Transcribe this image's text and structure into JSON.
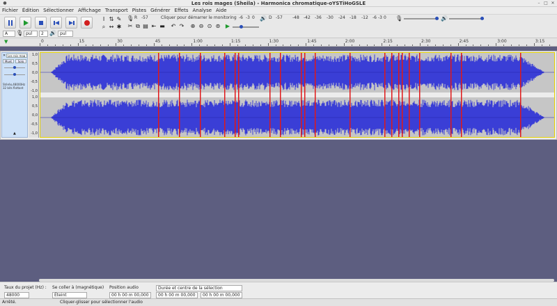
{
  "window": {
    "title": "Les rois mages (Sheila) - Harmonica chromatique-oYSTiHoGSLE",
    "menus": [
      "Fichier",
      "Édition",
      "Sélectionner",
      "Affichage",
      "Transport",
      "Pistes",
      "Générer",
      "Effets",
      "Analyse",
      "Aide"
    ]
  },
  "toolbar": {
    "record_meter_label": "R",
    "play_meter_label": "D",
    "record_meter_ticks": [
      "-57",
      "Cliquer pour démarrer le monitoring",
      "-6",
      "-3",
      "0"
    ],
    "play_meter_ticks": [
      "-57",
      "-48",
      "-42",
      "-36",
      "-30",
      "-24",
      "-18",
      "-12",
      "-6",
      "-3",
      "0"
    ],
    "host": "A",
    "record_device": "pul",
    "channels": "2",
    "playback_device": "pul"
  },
  "timeline": {
    "labels": [
      "0",
      "15",
      "30",
      "45",
      "1:00",
      "1:15",
      "1:30",
      "1:45",
      "2:00",
      "2:15",
      "2:30",
      "2:45",
      "3:00",
      "3:15"
    ]
  },
  "track": {
    "name": "Les rois mag",
    "mute": "Muet",
    "solo": "Solo",
    "info1": "Stéréo,48000Hz",
    "info2": "32 bits flottant",
    "ruler_top": [
      "1,0",
      "0,5",
      "0,0",
      "-0,5",
      "-1,0"
    ],
    "ruler_bottom": [
      "1,0",
      "0,5",
      "0,0",
      "-0,5",
      "-1,0"
    ]
  },
  "bottom": {
    "rate_label": "Taux du projet (Hz) :",
    "rate_value": "48000",
    "snap_label": "Se coller à (magnétique)",
    "snap_value": "Éteint",
    "pos_label": "Position audio",
    "pos_value": "00 h 00 m 00,000 s",
    "sel_mode": "Durée et centre de la sélection",
    "sel_start": "00 h 00 m 00,000 s",
    "sel_end": "00 h 00 m 00,000 s"
  },
  "status": {
    "state": "Arrêté.",
    "hint": "Cliquer-glisser pour sélectionner l'audio"
  },
  "colors": {
    "waveform": "#3a3ed6",
    "waveform_bg": "#c6c6c6",
    "markers": "#e01818",
    "workspace": "#5d5e80",
    "track_panel": "#cde1f8"
  }
}
